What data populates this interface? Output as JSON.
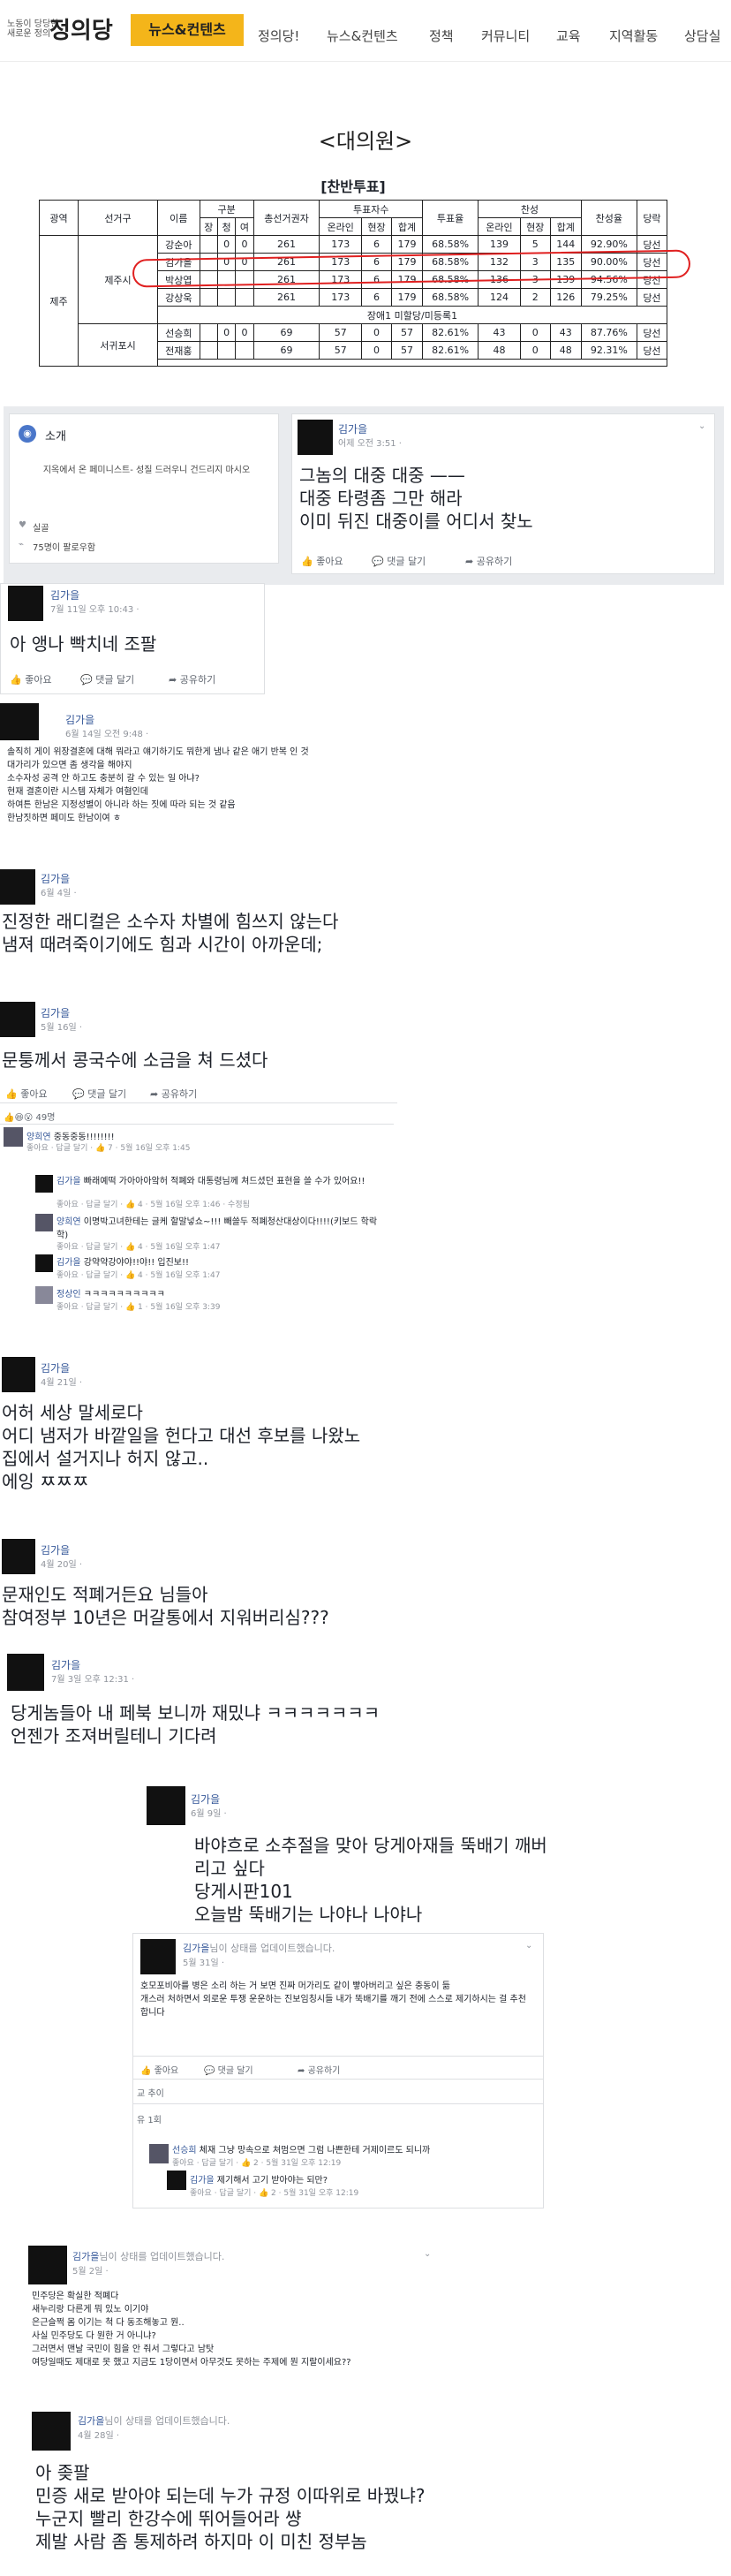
{
  "nav": {
    "logo_small": "노동이 당당한\n새로운 정의",
    "logo_main": "정의당",
    "active": "뉴스&컨텐츠",
    "items": [
      "정의당!",
      "뉴스&컨텐츠",
      "정책",
      "커뮤니티",
      "교육",
      "지역활동",
      "상담실"
    ]
  },
  "section_title": "<대의원>",
  "table": {
    "caption": "[찬반투표]",
    "h_region": "광역",
    "h_district": "선거구",
    "h_name": "이름",
    "h_group": "구분",
    "h_group_sub": [
      "장",
      "청",
      "여"
    ],
    "h_total": "총선거권자",
    "h_votes": "투표자수",
    "h_votes_sub": [
      "온라인",
      "현장",
      "합계"
    ],
    "h_rate": "투표율",
    "h_yes": "찬성",
    "h_yes_sub": [
      "온라인",
      "현장",
      "합계"
    ],
    "h_yes_rate": "찬성율",
    "h_result": "당락",
    "region": "제주",
    "district1": "제주시",
    "district2": "서귀포시",
    "rows1": [
      [
        "강순아",
        "0",
        "0",
        "261",
        "173",
        "6",
        "179",
        "68.58%",
        "139",
        "5",
        "144",
        "92.90%",
        "당선"
      ],
      [
        "김가을",
        "0",
        "0",
        "261",
        "173",
        "6",
        "179",
        "68.58%",
        "132",
        "3",
        "135",
        "90.00%",
        "당선"
      ],
      [
        "박상엽",
        "",
        "",
        "261",
        "173",
        "6",
        "179",
        "68.58%",
        "136",
        "3",
        "139",
        "94.56%",
        "당선"
      ],
      [
        "강상욱",
        "",
        "",
        "261",
        "173",
        "6",
        "179",
        "68.58%",
        "124",
        "2",
        "126",
        "79.25%",
        "당선"
      ]
    ],
    "mid_row": "장애1 미할당/미등록1",
    "rows2": [
      [
        "선승희",
        "0",
        "0",
        "69",
        "57",
        "0",
        "57",
        "82.61%",
        "43",
        "0",
        "43",
        "87.76%",
        "당선"
      ],
      [
        "전재홍",
        "",
        "",
        "69",
        "57",
        "0",
        "57",
        "82.61%",
        "48",
        "0",
        "48",
        "92.31%",
        "당선"
      ]
    ]
  },
  "intro": {
    "icon_label": "소개",
    "desc": "지옥에서 온 페미니스트- 성질 드러우니 건드리지 마시오",
    "job": "실골",
    "followers": "75명이 팔로우함"
  },
  "post1": {
    "name": "김가을",
    "time": "어제 오전 3:51 · ",
    "text": "그놈의 대중 대중 ——\n대중 타령좀 그만 해라\n이미 뒤진 대중이를 어디서 찾노",
    "like": "좋아요",
    "comment": "댓글 달기",
    "share": "공유하기"
  },
  "post2": {
    "name": "김가을",
    "time": "7월 11일 오후 10:43 · ",
    "text": "아 앵나 빡치네 조팔",
    "like": "좋아요",
    "comment": "댓글 달기",
    "share": "공유하기"
  },
  "post3": {
    "name": "김가을",
    "time": "6월 14일 오전 9:48 · ",
    "text": "솔직히 게이 위장결혼에 대해 뭐라고 얘기하기도 뭐한게 냄나 같은 애기 반복 인 것\n대가리가 있으면 좀 생각을 해야지\n소수자성 공격 안 하고도 충분히 갈 수 있는 일 아냐?\n현재 결혼이란 시스템 자체가 여혐인데\n하여튼 한남은 지정성별이 아니라 하는 짓에 따라 되는 것 같음\n한남짓하면 페미도 한남이여 ㅎ"
  },
  "post4": {
    "name": "김가을",
    "time": "6월 4일 · ",
    "text": "진정한 래디컬은 소수자 차별에 힘쓰지 않는다\n냄져 때려죽이기에도 힘과 시간이 아까운데;"
  },
  "post5": {
    "name": "김가을",
    "time": "5월 16일 · ",
    "text": "문퉁께서 콩국수에 소금을 쳐 드셨다",
    "like": "좋아요",
    "comment": "댓글 달기",
    "share": "공유하기",
    "reactions": "49명",
    "comments": [
      {
        "who": "양희연",
        "text": " 중동중동!!!!!!!!",
        "meta": "좋아요 · 답글 달기 · 👍 7 · 5월 16일 오후 1:45"
      },
      {
        "who": "김가을",
        "text": " 빠래예떡 가아아아앜허 적폐와 대통령님께 쳐드셨던 표현을 쓸 수가 있어요!!",
        "meta": "좋아요 · 답글 달기 · 👍 4 · 5월 16일 오후 1:46 · 수정됨"
      },
      {
        "who": "양희연",
        "text": " 이명박고녀한테는 글케 할말넣쇼~!!! 빼쓸두 적폐청산대상이다!!!!(키보드 학락학)",
        "meta": "좋아요 · 답글 달기 · 👍 4 · 5월 16일 오후 1:47"
      },
      {
        "who": "김가을",
        "text": " 강약약강야야!!야!! 입진보!!",
        "meta": "좋아요 · 답글 달기 · 👍 4 · 5월 16일 오후 1:47"
      },
      {
        "who": "정상인",
        "text": " ㅋㅋㅋㅋㅋㅋㅋㅋㅋㅋ",
        "meta": "좋아요 · 답글 달기 · 👍 1 · 5월 16일 오후 3:39"
      }
    ]
  },
  "post6": {
    "name": "김가을",
    "time": "4월 21일 · ",
    "text": "어허 세상 말세로다\n어디 냄저가 바깥일을 헌다고 대선 후보를 나왔노\n집에서 설거지나 허지 않고..\n에잉 ㅉㅉㅉ"
  },
  "post7": {
    "name": "김가을",
    "time": "4월 20일 · ",
    "text": "문재인도 적폐거든요 님들아\n참여정부 10년은 머갈통에서 지워버리심???"
  },
  "post8": {
    "name": "김가을",
    "time": "7월 3일 오후 12:31 · ",
    "text": "당게놈들아 내 페북 보니까 재밌냐 ㅋㅋㅋㅋㅋㅋㅋ\n언젠가 조져버릴테니 기다려"
  },
  "post9": {
    "name": "김가을",
    "time": "6월 9일 · ",
    "text": "바야흐로 소추절을 맞아 당게아재들 뚝배기 깨버리고 싶다\n당게시판101\n오늘밤 뚝배기는 나야나 나야나"
  },
  "post10": {
    "name": "김가을",
    "name_suffix": "님이 상태를 업데이트했습니다.",
    "time": "5월 31일 · ",
    "text": "호모포비아를 병은 소리 하는 거 보면 진짜 머가리도 같이 빻아버리고 싶은 충동이 듦\n개스러 처하면서 외로운 투쟁 운운하는 진보임칭시들 내가 뚝배기를 깨기 전에 스스로 제기하시는 걸 추천합니다",
    "like": "좋아요",
    "comment": "댓글 달기",
    "share": "공유하기",
    "line1": "교 추이",
    "line2": "유 1회",
    "comments": [
      {
        "who": "선승희",
        "text": " 체재 그냥 망속으로 쳐멈으면 그럼 나쁜한테 거제이르도 되니까",
        "meta": "좋아요 · 답글 달기 · 👍 2 · 5월 31일 오후 12:19"
      },
      {
        "who": "김가을",
        "text": " 제기해서 고기 받아야는 되만?",
        "meta": "좋아요 · 답글 달기 · 👍 2 · 5월 31일 오후 12:19"
      }
    ]
  },
  "post11": {
    "name": "김가을",
    "name_suffix": "님이 상태를 업데이트했습니다.",
    "time": "5월 2일 · ",
    "text": "민주당은 확실한 적폐다\n새누리랑 다른게 뭐 있노 이기야\n은근슬쩍 몸 이기는 척 다 동조해놓고 뭔..\n사실 민주당도 다 뭔한 거 아니냐?\n그러면서 맨날 국민이 힘을 안 줘서 그렇다고 남탓\n여당일때도 제대로 못 했고 지금도 1당이면서 아무것도 못하는 주제에 뭔 지랄이세요??"
  },
  "post12": {
    "name": "김가을",
    "name_suffix": "님이 상태를 업데이트했습니다.",
    "time": "4월 28일 · ",
    "text": "아 좆팔\n민증 새로 받아야 되는데 누가 규정 이따위로 바꿨냐?\n누군지 빨리 한강수에 뛰어들어라 썅\n제발 사람 좀 통제하려 하지마 이 미친 정부놈"
  }
}
